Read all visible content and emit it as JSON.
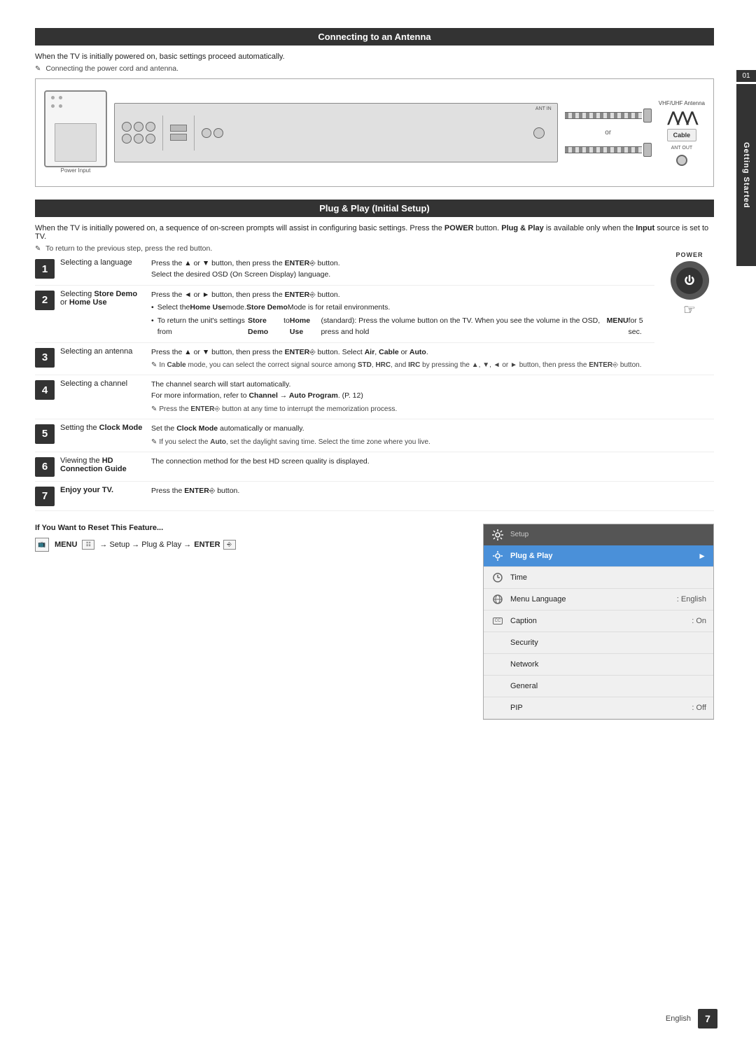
{
  "page": {
    "chapter_number": "01",
    "chapter_title": "Getting Started",
    "page_number": "7",
    "footer_language": "English"
  },
  "section1": {
    "title": "Connecting to an Antenna",
    "intro": "When the TV is initially powered on, basic settings proceed automatically.",
    "note": "Connecting the power cord and antenna.",
    "diagram": {
      "power_input_label": "Power Input",
      "ant_in_label": "ANT IN",
      "vhf_uhf_label": "VHF/UHF Antenna",
      "or_text": "or",
      "cable_label": "Cable",
      "ant_out_label": "ANT OUT"
    }
  },
  "section2": {
    "title": "Plug & Play (Initial Setup)",
    "intro": "When the TV is initially powered on, a sequence of on-screen prompts will assist in configuring basic settings. Press the POWER button. Plug & Play is available only when the Input source is set to TV.",
    "note": "To return to the previous step, press the red button.",
    "power_label": "POWER",
    "steps": [
      {
        "number": "1",
        "label": "Selecting a language",
        "content": "Press the ▲ or ▼ button, then press the ENTER button.\nSelect the desired OSD (On Screen Display) language."
      },
      {
        "number": "2",
        "label_bold": "Store Demo",
        "label_prefix": "Selecting ",
        "label_suffix_bold": "Home Use",
        "label_suffix_prefix": "or ",
        "content_main": "Press the ◄ or ► button, then press the ENTER button.",
        "bullet1": "Select the Home Use mode. Store Demo Mode is for retail environments.",
        "bullet2": "To return the unit's settings from Store Demo to Home Use (standard): Press the volume button on the TV. When you see the volume in the OSD, press and hold MENU for 5 sec."
      },
      {
        "number": "3",
        "label": "Selecting an antenna",
        "content": "Press the ▲ or ▼ button, then press the ENTER button. Select Air, Cable or Auto.",
        "note": "In Cable mode, you can select the correct signal source among STD, HRC, and IRC by pressing the ▲, ▼, ◄ or ► button, then press the ENTER button."
      },
      {
        "number": "4",
        "label": "Selecting a channel",
        "content": "The channel search will start automatically.\nFor more information, refer to Channel → Auto Program. (P. 12)",
        "note": "Press the ENTER button at any time to interrupt the memorization process."
      },
      {
        "number": "5",
        "label_prefix": "Setting the ",
        "label_bold": "Clock Mode",
        "content": "Set the Clock Mode automatically or manually.",
        "note": "If you select the Auto, set the daylight saving time. Select the time zone where you live."
      },
      {
        "number": "6",
        "label_prefix": "Viewing the ",
        "label_bold": "HD Connection Guide",
        "content": "The connection method for the best HD screen quality is displayed."
      },
      {
        "number": "7",
        "label_bold": "Enjoy your TV.",
        "content": "Press the ENTER button."
      }
    ]
  },
  "reset_section": {
    "title": "If You Want to Reset This Feature...",
    "instruction": "MENU → Setup → Plug & Play → ENTER"
  },
  "osd_menu": {
    "header_icon": "gear",
    "rows": [
      {
        "icon": "gear",
        "label": "Plug & Play",
        "value": "",
        "highlighted": true,
        "arrow": "►"
      },
      {
        "icon": "clock",
        "label": "Time",
        "value": "",
        "highlighted": false,
        "arrow": ""
      },
      {
        "icon": "globe",
        "label": "Menu Language",
        "value": ": English",
        "highlighted": false,
        "arrow": ""
      },
      {
        "icon": "caption",
        "label": "Caption",
        "value": ": On",
        "highlighted": false,
        "arrow": ""
      },
      {
        "icon": "",
        "label": "Security",
        "value": "",
        "highlighted": false,
        "arrow": ""
      },
      {
        "icon": "",
        "label": "Network",
        "value": "",
        "highlighted": false,
        "arrow": ""
      },
      {
        "icon": "",
        "label": "General",
        "value": "",
        "highlighted": false,
        "arrow": ""
      },
      {
        "icon": "",
        "label": "PIP",
        "value": ": Off",
        "highlighted": false,
        "arrow": ""
      }
    ]
  }
}
